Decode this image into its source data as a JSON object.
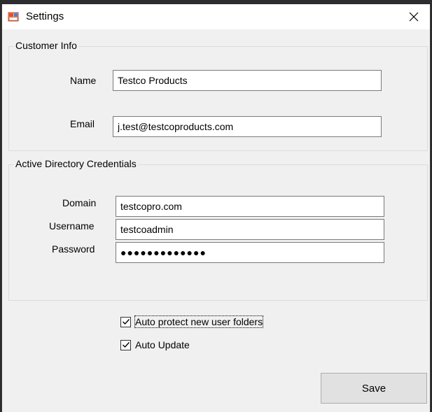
{
  "window": {
    "title": "Settings"
  },
  "customer_info": {
    "group_label": "Customer Info",
    "name_label": "Name",
    "name_value": "Testco Products",
    "email_label": "Email",
    "email_value": "j.test@testcoproducts.com"
  },
  "ad_credentials": {
    "group_label": "Active Directory Credentials",
    "domain_label": "Domain",
    "domain_value": "testcopro.com",
    "username_label": "Username",
    "username_value": "testcoadmin",
    "password_label": "Password",
    "password_masked": "●●●●●●●●●●●●●"
  },
  "options": {
    "auto_protect_label": "Auto protect new user folders",
    "auto_protect_checked": true,
    "auto_update_label": "Auto Update",
    "auto_update_checked": true
  },
  "actions": {
    "save_label": "Save"
  },
  "icons": {
    "app": "settings-window-icon",
    "close": "close-icon",
    "check": "checkmark-icon"
  }
}
